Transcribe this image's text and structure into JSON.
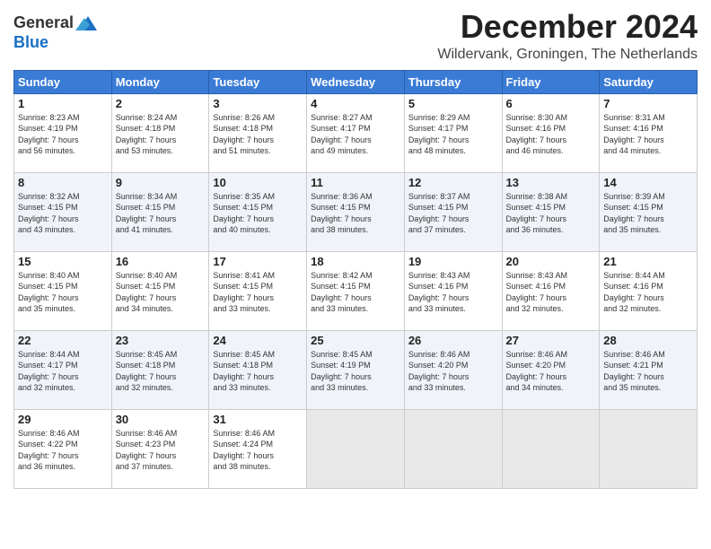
{
  "header": {
    "logo_line1": "General",
    "logo_line2": "Blue",
    "month": "December 2024",
    "location": "Wildervank, Groningen, The Netherlands"
  },
  "weekdays": [
    "Sunday",
    "Monday",
    "Tuesday",
    "Wednesday",
    "Thursday",
    "Friday",
    "Saturday"
  ],
  "weeks": [
    [
      {
        "day": "1",
        "lines": [
          "Sunrise: 8:23 AM",
          "Sunset: 4:19 PM",
          "Daylight: 7 hours",
          "and 56 minutes."
        ]
      },
      {
        "day": "2",
        "lines": [
          "Sunrise: 8:24 AM",
          "Sunset: 4:18 PM",
          "Daylight: 7 hours",
          "and 53 minutes."
        ]
      },
      {
        "day": "3",
        "lines": [
          "Sunrise: 8:26 AM",
          "Sunset: 4:18 PM",
          "Daylight: 7 hours",
          "and 51 minutes."
        ]
      },
      {
        "day": "4",
        "lines": [
          "Sunrise: 8:27 AM",
          "Sunset: 4:17 PM",
          "Daylight: 7 hours",
          "and 49 minutes."
        ]
      },
      {
        "day": "5",
        "lines": [
          "Sunrise: 8:29 AM",
          "Sunset: 4:17 PM",
          "Daylight: 7 hours",
          "and 48 minutes."
        ]
      },
      {
        "day": "6",
        "lines": [
          "Sunrise: 8:30 AM",
          "Sunset: 4:16 PM",
          "Daylight: 7 hours",
          "and 46 minutes."
        ]
      },
      {
        "day": "7",
        "lines": [
          "Sunrise: 8:31 AM",
          "Sunset: 4:16 PM",
          "Daylight: 7 hours",
          "and 44 minutes."
        ]
      }
    ],
    [
      {
        "day": "8",
        "lines": [
          "Sunrise: 8:32 AM",
          "Sunset: 4:15 PM",
          "Daylight: 7 hours",
          "and 43 minutes."
        ]
      },
      {
        "day": "9",
        "lines": [
          "Sunrise: 8:34 AM",
          "Sunset: 4:15 PM",
          "Daylight: 7 hours",
          "and 41 minutes."
        ]
      },
      {
        "day": "10",
        "lines": [
          "Sunrise: 8:35 AM",
          "Sunset: 4:15 PM",
          "Daylight: 7 hours",
          "and 40 minutes."
        ]
      },
      {
        "day": "11",
        "lines": [
          "Sunrise: 8:36 AM",
          "Sunset: 4:15 PM",
          "Daylight: 7 hours",
          "and 38 minutes."
        ]
      },
      {
        "day": "12",
        "lines": [
          "Sunrise: 8:37 AM",
          "Sunset: 4:15 PM",
          "Daylight: 7 hours",
          "and 37 minutes."
        ]
      },
      {
        "day": "13",
        "lines": [
          "Sunrise: 8:38 AM",
          "Sunset: 4:15 PM",
          "Daylight: 7 hours",
          "and 36 minutes."
        ]
      },
      {
        "day": "14",
        "lines": [
          "Sunrise: 8:39 AM",
          "Sunset: 4:15 PM",
          "Daylight: 7 hours",
          "and 35 minutes."
        ]
      }
    ],
    [
      {
        "day": "15",
        "lines": [
          "Sunrise: 8:40 AM",
          "Sunset: 4:15 PM",
          "Daylight: 7 hours",
          "and 35 minutes."
        ]
      },
      {
        "day": "16",
        "lines": [
          "Sunrise: 8:40 AM",
          "Sunset: 4:15 PM",
          "Daylight: 7 hours",
          "and 34 minutes."
        ]
      },
      {
        "day": "17",
        "lines": [
          "Sunrise: 8:41 AM",
          "Sunset: 4:15 PM",
          "Daylight: 7 hours",
          "and 33 minutes."
        ]
      },
      {
        "day": "18",
        "lines": [
          "Sunrise: 8:42 AM",
          "Sunset: 4:15 PM",
          "Daylight: 7 hours",
          "and 33 minutes."
        ]
      },
      {
        "day": "19",
        "lines": [
          "Sunrise: 8:43 AM",
          "Sunset: 4:16 PM",
          "Daylight: 7 hours",
          "and 33 minutes."
        ]
      },
      {
        "day": "20",
        "lines": [
          "Sunrise: 8:43 AM",
          "Sunset: 4:16 PM",
          "Daylight: 7 hours",
          "and 32 minutes."
        ]
      },
      {
        "day": "21",
        "lines": [
          "Sunrise: 8:44 AM",
          "Sunset: 4:16 PM",
          "Daylight: 7 hours",
          "and 32 minutes."
        ]
      }
    ],
    [
      {
        "day": "22",
        "lines": [
          "Sunrise: 8:44 AM",
          "Sunset: 4:17 PM",
          "Daylight: 7 hours",
          "and 32 minutes."
        ]
      },
      {
        "day": "23",
        "lines": [
          "Sunrise: 8:45 AM",
          "Sunset: 4:18 PM",
          "Daylight: 7 hours",
          "and 32 minutes."
        ]
      },
      {
        "day": "24",
        "lines": [
          "Sunrise: 8:45 AM",
          "Sunset: 4:18 PM",
          "Daylight: 7 hours",
          "and 33 minutes."
        ]
      },
      {
        "day": "25",
        "lines": [
          "Sunrise: 8:45 AM",
          "Sunset: 4:19 PM",
          "Daylight: 7 hours",
          "and 33 minutes."
        ]
      },
      {
        "day": "26",
        "lines": [
          "Sunrise: 8:46 AM",
          "Sunset: 4:20 PM",
          "Daylight: 7 hours",
          "and 33 minutes."
        ]
      },
      {
        "day": "27",
        "lines": [
          "Sunrise: 8:46 AM",
          "Sunset: 4:20 PM",
          "Daylight: 7 hours",
          "and 34 minutes."
        ]
      },
      {
        "day": "28",
        "lines": [
          "Sunrise: 8:46 AM",
          "Sunset: 4:21 PM",
          "Daylight: 7 hours",
          "and 35 minutes."
        ]
      }
    ],
    [
      {
        "day": "29",
        "lines": [
          "Sunrise: 8:46 AM",
          "Sunset: 4:22 PM",
          "Daylight: 7 hours",
          "and 36 minutes."
        ]
      },
      {
        "day": "30",
        "lines": [
          "Sunrise: 8:46 AM",
          "Sunset: 4:23 PM",
          "Daylight: 7 hours",
          "and 37 minutes."
        ]
      },
      {
        "day": "31",
        "lines": [
          "Sunrise: 8:46 AM",
          "Sunset: 4:24 PM",
          "Daylight: 7 hours",
          "and 38 minutes."
        ]
      },
      {
        "day": "",
        "lines": []
      },
      {
        "day": "",
        "lines": []
      },
      {
        "day": "",
        "lines": []
      },
      {
        "day": "",
        "lines": []
      }
    ]
  ]
}
